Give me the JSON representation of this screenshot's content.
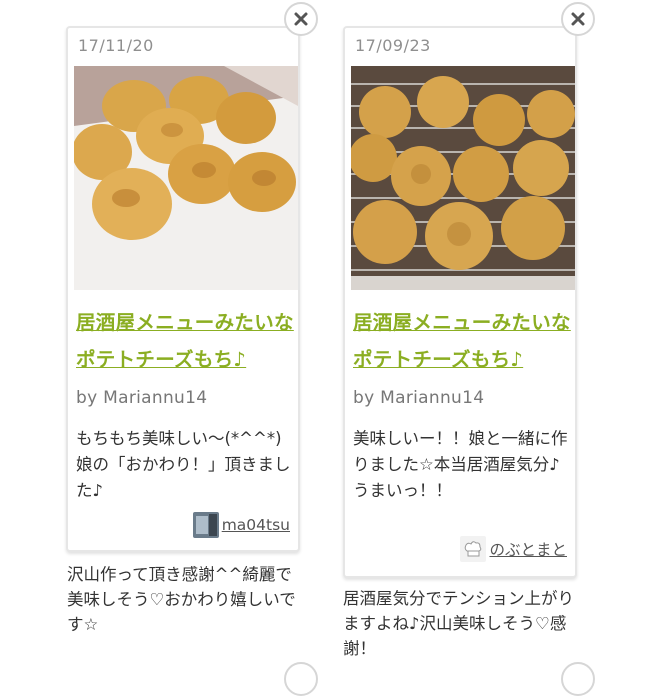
{
  "cards": [
    {
      "date": "17/11/20",
      "title": "居酒屋メニューみたいなポテトチーズもち♪",
      "by_label": "by Mariannu14",
      "comment": "もちもち美味しい〜(*^^*)娘の「おかわり！」頂きました♪",
      "author": "ma04tsu",
      "reply": "沢山作って頂き感謝^^綺麗で美味しそう♡おかわり嬉しいです☆",
      "close_icon": "close-icon"
    },
    {
      "date": "17/09/23",
      "title": "居酒屋メニューみたいなポテトチーズもち♪",
      "by_label": "by Mariannu14",
      "comment": "美味しいー！！娘と一緒に作りました☆本当居酒屋気分♪うまいっ！！",
      "author": "のぶとまと",
      "reply": "居酒屋気分でテンション上がりますよね♪沢山美味しそう♡感謝！",
      "close_icon": "close-icon"
    }
  ],
  "colors": {
    "title_link": "#8bae22",
    "date": "#8f8f8f",
    "border": "#e6e6e6"
  }
}
